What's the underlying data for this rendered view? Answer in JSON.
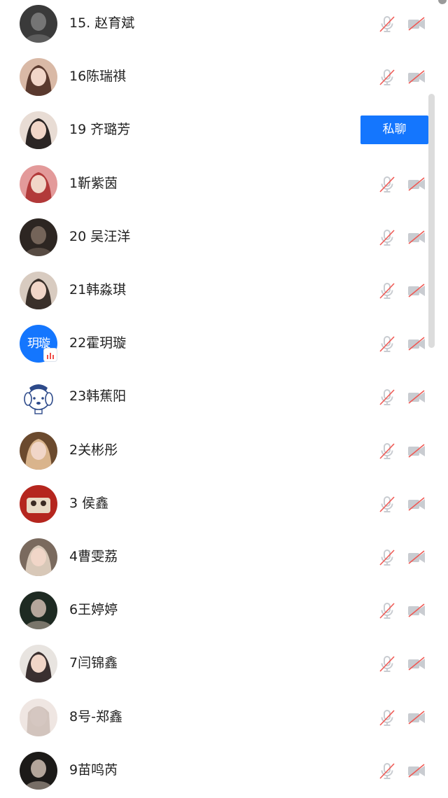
{
  "private_chat_label": "私聊",
  "members": [
    {
      "name": "15. 赵育斌",
      "avatar": "photo-dark",
      "colors": [
        "#3a3a3a",
        "#8a8a8a"
      ]
    },
    {
      "name": "16陈瑞祺",
      "avatar": "photo-portrait",
      "colors": [
        "#d9b9a6",
        "#5a3a2e"
      ]
    },
    {
      "name": "19 齐璐芳",
      "avatar": "photo-portrait",
      "colors": [
        "#e8dcd4",
        "#2b2524"
      ],
      "hovered": true
    },
    {
      "name": "1靳紫茵",
      "avatar": "photo-portrait",
      "colors": [
        "#e39a9a",
        "#b23a3a"
      ]
    },
    {
      "name": "20 吴汪洋",
      "avatar": "photo-dark",
      "colors": [
        "#2d2622",
        "#8c7a6c"
      ]
    },
    {
      "name": "21韩淼琪",
      "avatar": "photo-portrait",
      "colors": [
        "#d8cbc0",
        "#3a302a"
      ]
    },
    {
      "name": "22霍玥璇",
      "avatar": "text",
      "avatar_text": "玥璇",
      "colors": [
        "#1476fe",
        "#ffffff"
      ],
      "speaking": true
    },
    {
      "name": "23韩蕉阳",
      "avatar": "cartoon-dog",
      "colors": [
        "#ffffff",
        "#2d4a8a"
      ]
    },
    {
      "name": "2关彬彤",
      "avatar": "photo-portrait",
      "colors": [
        "#6b4a2e",
        "#d9b48c"
      ]
    },
    {
      "name": "3 侯鑫",
      "avatar": "photo-red",
      "colors": [
        "#b5261e",
        "#e8d9c4"
      ]
    },
    {
      "name": "4曹雯荔",
      "avatar": "photo-portrait",
      "colors": [
        "#7a6a5e",
        "#d8c8b8"
      ]
    },
    {
      "name": "6王婷婷",
      "avatar": "photo-dark",
      "colors": [
        "#1e2a22",
        "#e8d0c4"
      ]
    },
    {
      "name": "7闫锦鑫",
      "avatar": "photo-portrait",
      "colors": [
        "#e8e4e0",
        "#3a3030"
      ]
    },
    {
      "name": "8号-郑鑫",
      "avatar": "photo-light",
      "colors": [
        "#efe6e2",
        "#b9a89e"
      ]
    },
    {
      "name": "9苗鸣芮",
      "avatar": "photo-dark",
      "colors": [
        "#1c1a18",
        "#e6d4c6"
      ]
    }
  ]
}
